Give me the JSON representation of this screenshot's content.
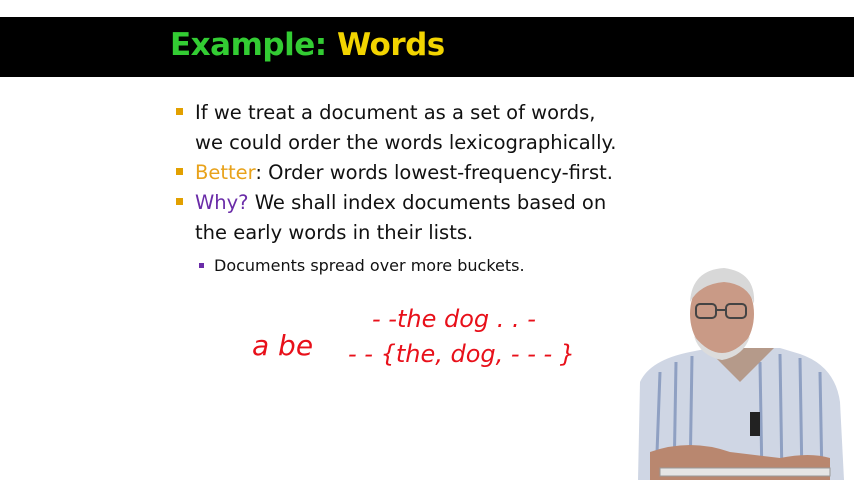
{
  "slide": {
    "title_part1": "Example:",
    "title_part2": "Words"
  },
  "bullets": {
    "b1_line1": "If we treat a document as a set of words,",
    "b1_line2": "we could order the words lexicographically.",
    "b2_keyword": "Better",
    "b2_rest": ": Order words lowest-frequency-first.",
    "b3_keyword": "Why?",
    "b3_line1_rest": " We shall index documents based on",
    "b3_line2": "the early words in their lists.",
    "sub1": "Documents spread over more buckets."
  },
  "annotation": {
    "line1": "- -the dog . . -",
    "line2_left": "a be",
    "line2_right": "- - {the, dog, - - -    }"
  },
  "colors": {
    "title_green": "#33cc33",
    "title_yellow": "#f2d400",
    "bullet_orange": "#e2a000",
    "accent_purple": "#6a2ca8",
    "ink_red": "#e8101a"
  }
}
